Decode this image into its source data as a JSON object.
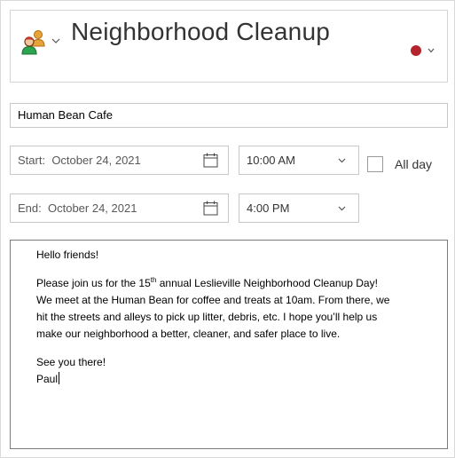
{
  "event": {
    "title": "Neighborhood Cleanup",
    "people_icon": "people-icon",
    "color_dot": "#b4242d"
  },
  "location": {
    "value": "Human Bean Cafe"
  },
  "start": {
    "date_label": "Start:",
    "date_value": "October 24, 2021",
    "time": "10:00 AM"
  },
  "end": {
    "date_label": "End:",
    "date_value": "October 24, 2021",
    "time": "4:00 PM"
  },
  "all_day": {
    "label": "All day",
    "checked": false
  },
  "body": {
    "greeting": "Hello friends!",
    "para_part1": "Please join us for the 15",
    "para_sup": "th",
    "para_part2": " annual Leslieville Neighborhood Cleanup Day!",
    "line2": "We meet at the Human Bean for coffee and treats at 10am. From there, we",
    "line3": "hit the streets and alleys to pick up litter, debris, etc. I hope you’ll help us",
    "line4": "make our neighborhood a better, cleaner, and safer place to live.",
    "closing": "See you there!",
    "signature": "Paul"
  }
}
